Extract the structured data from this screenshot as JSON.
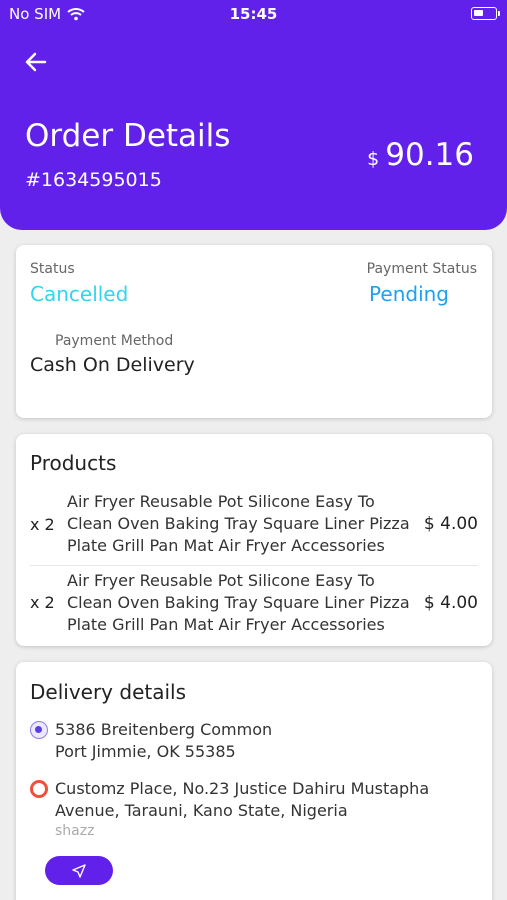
{
  "status_bar": {
    "carrier": "No SIM",
    "time": "15:45"
  },
  "header": {
    "title": "Order Details",
    "order_number": "#1634595015",
    "currency": "$",
    "total": "90.16"
  },
  "status_card": {
    "status_label": "Status",
    "status_value": "Cancelled",
    "payment_status_label": "Payment Status",
    "payment_status_value": "Pending",
    "payment_method_label": "Payment Method",
    "payment_method_value": "Cash On Delivery"
  },
  "products": {
    "title": "Products",
    "items": [
      {
        "qty": "x 2",
        "name": "Air Fryer Reusable Pot Silicone Easy To Clean Oven Baking Tray Square Liner Pizza Plate Grill Pan Mat Air Fryer Accessories",
        "price": "$ 4.00"
      },
      {
        "qty": "x 2",
        "name": "Air Fryer Reusable Pot Silicone Easy To Clean Oven Baking Tray Square Liner Pizza Plate Grill Pan Mat Air Fryer Accessories",
        "price": "$ 4.00"
      }
    ]
  },
  "delivery": {
    "title": "Delivery details",
    "pickup_line1": "5386 Breitenberg Common",
    "pickup_line2": "Port Jimmie, OK 55385",
    "dropoff_line1": "Customz Place, No.23 Justice Dahiru Mustapha",
    "dropoff_line2": "Avenue, Tarauni, Kano State, Nigeria",
    "dropoff_note": "shazz"
  },
  "colors": {
    "accent": "#6221ea",
    "status_cancelled": "#2fd7ee",
    "status_pending": "#1da1f2",
    "dropoff_marker": "#f04f3a"
  },
  "icons": [
    "wifi-icon",
    "battery-icon",
    "back-arrow-icon",
    "navigation-icon"
  ]
}
